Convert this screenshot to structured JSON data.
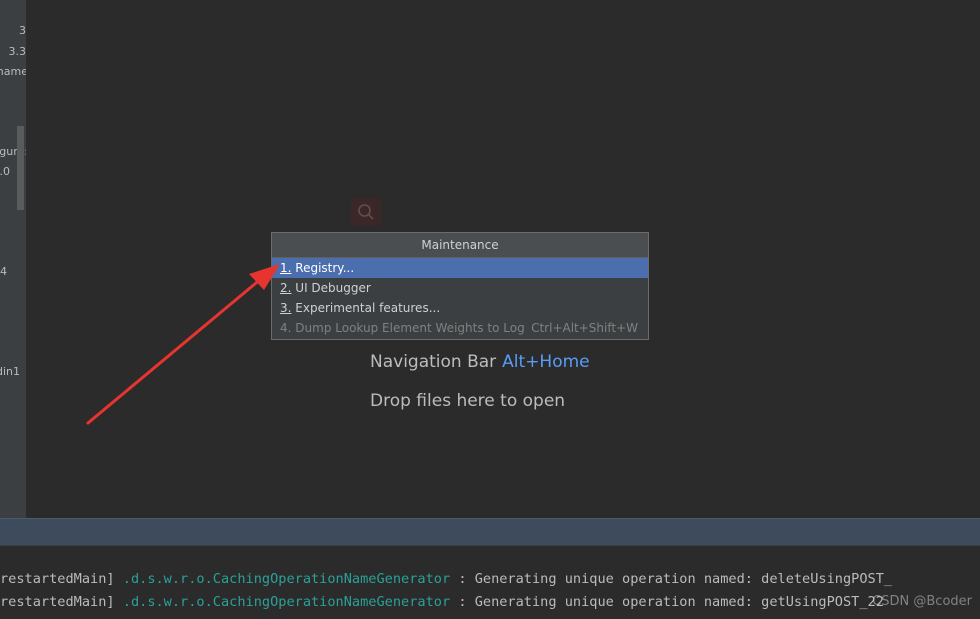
{
  "left_panel": {
    "fragments": [
      "3",
      "3.3",
      "name",
      "gure:",
      ".0",
      "4",
      "din1"
    ]
  },
  "popup": {
    "title": "Maintenance",
    "items": [
      {
        "num": "1.",
        "label": "Registry...",
        "shortcut": ""
      },
      {
        "num": "2.",
        "label": "UI Debugger",
        "shortcut": ""
      },
      {
        "num": "3.",
        "label": "Experimental features...",
        "shortcut": ""
      },
      {
        "num": "4.",
        "label": "Dump Lookup Element Weights to Log",
        "shortcut": "Ctrl+Alt+Shift+W"
      }
    ]
  },
  "hints": {
    "nav_label": "Navigation Bar",
    "nav_shortcut": "Alt+Home",
    "drop_label": "Drop files here to open"
  },
  "console": {
    "lines": [
      {
        "thread": "restartedMain]",
        "logger": ".d.s.w.r.o.CachingOperationNameGenerator",
        "message": ": Generating unique operation named: deleteUsingPOST_"
      },
      {
        "thread": "restartedMain]",
        "logger": ".d.s.w.r.o.CachingOperationNameGenerator",
        "message": ": Generating unique operation named: getUsingPOST_22"
      }
    ]
  },
  "watermark": "CSDN @Bcoder",
  "colors": {
    "background": "#2b2b2b",
    "selection": "#4b6eaf",
    "shortcut_link": "#589df6",
    "arrow": "#e8342e"
  },
  "icons": {
    "search": "search-icon"
  }
}
